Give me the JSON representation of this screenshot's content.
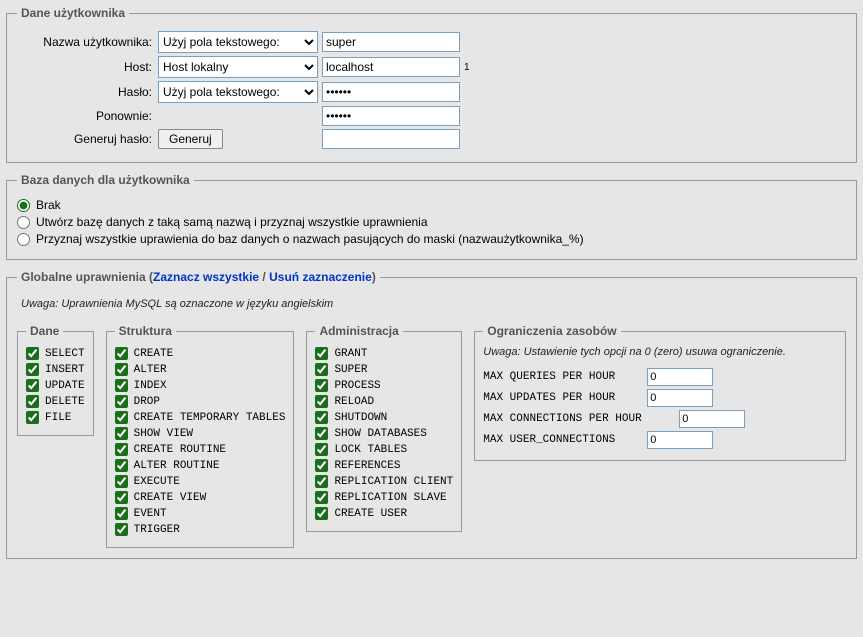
{
  "userData": {
    "legend": "Dane użytkownika",
    "labels": {
      "username": "Nazwa użytkownika:",
      "host": "Host:",
      "password": "Hasło:",
      "repeat": "Ponownie:",
      "gen": "Generuj hasło:"
    },
    "userSelect": "Użyj pola tekstowego:",
    "userValue": "super",
    "hostSelect": "Host lokalny",
    "hostValue": "localhost",
    "hostSup": "1",
    "passSelect": "Użyj pola tekstowego:",
    "passValue": "••••••",
    "repeatValue": "••••••",
    "genButton": "Generuj",
    "genValue": ""
  },
  "db": {
    "legend": "Baza danych dla użytkownika",
    "options": [
      "Brak",
      "Utwórz bazę danych z taką samą nazwą i przyznaj wszystkie uprawnienia",
      "Przyznaj wszystkie uprawienia do baz danych o nazwach pasujących do maski (nazwaużytkownika_%)"
    ],
    "selectedIndex": 0
  },
  "global": {
    "legendPrefix": "Globalne uprawnienia (",
    "checkAll": "Zaznacz wszystkie",
    "sep": " / ",
    "uncheckAll": "Usuń zaznaczenie",
    "legendSuffix": ")",
    "note": "Uwaga: Uprawnienia MySQL są oznaczone w języku angielskim"
  },
  "cols": {
    "data": {
      "legend": "Dane",
      "items": [
        "SELECT",
        "INSERT",
        "UPDATE",
        "DELETE",
        "FILE"
      ]
    },
    "structure": {
      "legend": "Struktura",
      "items": [
        "CREATE",
        "ALTER",
        "INDEX",
        "DROP",
        "CREATE TEMPORARY TABLES",
        "SHOW VIEW",
        "CREATE ROUTINE",
        "ALTER ROUTINE",
        "EXECUTE",
        "CREATE VIEW",
        "EVENT",
        "TRIGGER"
      ]
    },
    "admin": {
      "legend": "Administracja",
      "items": [
        "GRANT",
        "SUPER",
        "PROCESS",
        "RELOAD",
        "SHUTDOWN",
        "SHOW DATABASES",
        "LOCK TABLES",
        "REFERENCES",
        "REPLICATION CLIENT",
        "REPLICATION SLAVE",
        "CREATE USER"
      ]
    },
    "res": {
      "legend": "Ograniczenia zasobów",
      "note": "Uwaga: Ustawienie tych opcji na 0 (zero) usuwa ograniczenie.",
      "rows": [
        {
          "label": "MAX QUERIES PER HOUR",
          "value": "0"
        },
        {
          "label": "MAX UPDATES PER HOUR",
          "value": "0"
        },
        {
          "label": "MAX CONNECTIONS PER HOUR",
          "value": "0"
        },
        {
          "label": "MAX USER_CONNECTIONS",
          "value": "0"
        }
      ]
    }
  }
}
